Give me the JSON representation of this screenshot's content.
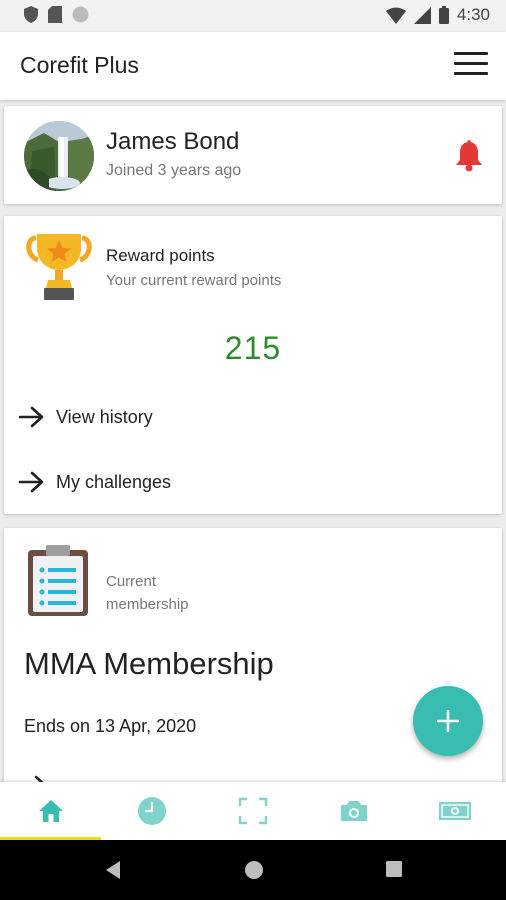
{
  "status_bar": {
    "time": "4:30",
    "left_icons": [
      "shield-icon",
      "sim-card-icon",
      "circle-icon"
    ],
    "right_icons": [
      "wifi-icon",
      "signal-icon",
      "battery-icon"
    ]
  },
  "app_bar": {
    "title": "Corefit Plus",
    "menu_icon": "hamburger-menu-icon"
  },
  "profile": {
    "name": "James Bond",
    "joined": "Joined 3 years ago",
    "notification_icon": "bell-icon",
    "notification_color": "#e53935"
  },
  "rewards": {
    "title": "Reward points",
    "subtitle": "Your current reward points",
    "points": "215",
    "points_color": "#2e8b2e",
    "links": [
      {
        "label": "View history"
      },
      {
        "label": "My challenges"
      }
    ]
  },
  "membership": {
    "label": "Current membership",
    "name": "MMA Membership",
    "ends": "Ends on 13 Apr, 2020"
  },
  "fab": {
    "label": "+",
    "color": "#38bdb0"
  },
  "bottom_nav": {
    "active_index": 0,
    "accent_color": "#38bdb0",
    "indicator_color": "#f0e000",
    "items": [
      {
        "icon": "home-icon"
      },
      {
        "icon": "clock-icon"
      },
      {
        "icon": "scan-frame-icon"
      },
      {
        "icon": "camera-icon"
      },
      {
        "icon": "money-icon"
      }
    ]
  },
  "system_nav": [
    "back-icon",
    "home-circle-icon",
    "recents-icon"
  ]
}
